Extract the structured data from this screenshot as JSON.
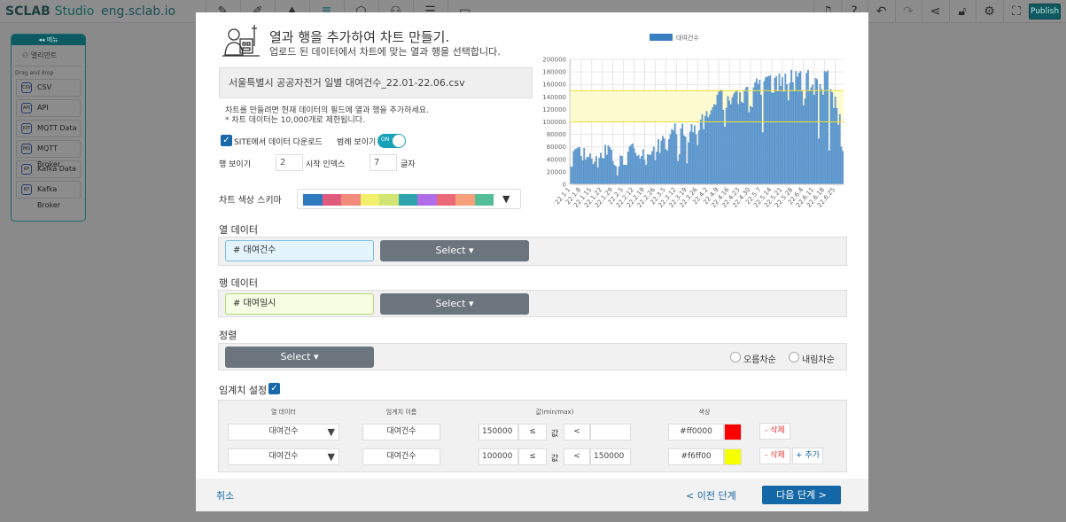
{
  "topbar": {
    "logo": "SCLAB",
    "logo_suffix": "Studio",
    "domain": "eng.sclab.io",
    "tools": [
      "edit-icon",
      "edit-alt-icon",
      "map-icon",
      "database-icon",
      "code-icon",
      "users-icon",
      "list-icon",
      "window-icon"
    ],
    "right_tools": [
      "bell-icon",
      "help-icon",
      "undo-icon",
      "redo-icon",
      "share-icon",
      "unlock-icon",
      "gear-icon",
      "fullscreen-icon"
    ],
    "publish": "Publish"
  },
  "panel": {
    "header": "메뉴",
    "client": "엘리먼트",
    "drag_label": "Drag and drop",
    "items": [
      {
        "label": "CSV",
        "icon": "CSV"
      },
      {
        "label": "API",
        "icon": "API"
      },
      {
        "label": "MQTT Data",
        "icon": "IOT"
      },
      {
        "label": "MQTT Broker",
        "icon": "MQ"
      },
      {
        "label": "Kafka Data",
        "icon": "KF"
      },
      {
        "label": "Kafka Broker",
        "icon": "KF"
      }
    ]
  },
  "modal": {
    "title": "열과 행을 추가하여 차트 만들기.",
    "subtitle": "업로드 된 데이터에서 차트에 맞는 열과 행을 선택합니다.",
    "file_name": "서울특별시 공공자전거 일별 대여건수_22.01-22.06.csv",
    "note1": "차트를 만들려면 현재 데이터의 필드에 열과 행을 추가하세요.",
    "note2": "* 차트 데이터는 10,000개로 제한됩니다.",
    "download_label": "SITE에서 데이터 다운로드",
    "download_checked": true,
    "legend_label": "범례 보이기",
    "legend_toggle": "ON",
    "rows_label": "행 보이기",
    "rows_value": "2",
    "start_index_label": "시작 인덱스",
    "start_index_value": "7",
    "chars_label": "글자",
    "color_scheme_label": "차트 색상 스키마",
    "color_scheme": [
      "#2e7bbf",
      "#e05a7e",
      "#f28b7a",
      "#f2ef6b",
      "#d2e574",
      "#2fa3ae",
      "#b06de8",
      "#ea6a7a",
      "#f5a07a",
      "#52bd96"
    ],
    "column_label": "열 데이터",
    "column_field": "# 대여건수",
    "column_select": "Select ▾",
    "row_label": "행 데이터",
    "row_field": "# 대여일시",
    "row_select": "Select ▾",
    "sort_label": "정렬",
    "sort_select": "Select ▾",
    "asc": "오름차순",
    "desc": "내림차순",
    "threshold_label": "임계치 설정",
    "threshold_checked": true,
    "threshold_headers": [
      "열 데이터",
      "임계치 이름",
      "값(min/max)",
      "색상"
    ],
    "thresholds": [
      {
        "column": "대여건수",
        "name": "대여건수",
        "min": "150000",
        "op1": "≤",
        "val": "값",
        "op2": "<",
        "max": "",
        "color": "#ff0000",
        "delete": "- 삭제"
      },
      {
        "column": "대여건수",
        "name": "대여건수",
        "min": "100000",
        "op1": "≤",
        "val": "값",
        "op2": "<",
        "max": "150000",
        "color": "#f6ff00",
        "delete": "- 삭제",
        "add": "+ 추가"
      }
    ],
    "cancel": "취소",
    "prev": "< 이전 단계",
    "next": "다음 단계 >"
  },
  "chart_data": {
    "type": "bar",
    "legend": [
      "대여건수"
    ],
    "legend_position": "top",
    "bar_color": "#3a80c0",
    "grid": true,
    "ylim": [
      0,
      200000
    ],
    "yticks": [
      0,
      20000,
      40000,
      60000,
      80000,
      100000,
      120000,
      140000,
      160000,
      180000,
      200000
    ],
    "x_tick_labels": [
      "22.1.1",
      "22.1.8",
      "22.1.15",
      "22.1.22",
      "22.1.29",
      "22.2.5",
      "22.2.12",
      "22.2.19",
      "22.2.26",
      "22.3.5",
      "22.3.12",
      "22.3.19",
      "22.3.26",
      "22.4.2",
      "22.4.9",
      "22.4.16",
      "22.4.23",
      "22.4.30",
      "22.5.7",
      "22.5.14",
      "22.5.21",
      "22.5.28",
      "22.6.4",
      "22.6.11",
      "22.6.18",
      "22.6.25"
    ],
    "thresholds": [
      {
        "min": 150000,
        "color": "#ff0000"
      },
      {
        "min": 100000,
        "max": 150000,
        "color": "#f6ff00"
      }
    ],
    "values": [
      28000,
      28000,
      53000,
      56000,
      57000,
      59000,
      59000,
      45000,
      38000,
      58000,
      39000,
      44000,
      43000,
      49000,
      41000,
      32000,
      36000,
      45000,
      27000,
      42000,
      50000,
      42000,
      41000,
      63000,
      47000,
      62000,
      59000,
      55000,
      37000,
      31000,
      29000,
      14000,
      28000,
      46000,
      45000,
      31000,
      31000,
      31000,
      52000,
      60000,
      63000,
      65000,
      58000,
      50000,
      45000,
      47000,
      41000,
      45000,
      56000,
      39000,
      31000,
      48000,
      47000,
      47000,
      53000,
      60000,
      38000,
      52000,
      72000,
      50000,
      70000,
      77000,
      73000,
      56000,
      54000,
      72000,
      80000,
      88000,
      86000,
      97000,
      80000,
      37000,
      48000,
      89000,
      97000,
      78000,
      76000,
      33000,
      67000,
      84000,
      96000,
      83000,
      94000,
      80000,
      62000,
      86000,
      103000,
      112000,
      88000,
      109000,
      117000,
      107000,
      111000,
      118000,
      123000,
      128000,
      127000,
      143000,
      148000,
      151000,
      151000,
      119000,
      92000,
      122000,
      141000,
      134000,
      128000,
      139000,
      145000,
      148000,
      149000,
      128000,
      147000,
      132000,
      130000,
      151000,
      155000,
      156000,
      115000,
      125000,
      123000,
      155000,
      163000,
      169000,
      160000,
      167000,
      143000,
      83000,
      165000,
      171000,
      172000,
      173000,
      174000,
      147000,
      146000,
      170000,
      173000,
      149000,
      177000,
      157000,
      171000,
      148000,
      177000,
      160000,
      134000,
      162000,
      183000,
      163000,
      149000,
      181000,
      172000,
      178000,
      181000,
      150000,
      126000,
      137000,
      178000,
      183000,
      150000,
      155000,
      159000,
      143000,
      170000,
      168000,
      73000,
      160000,
      152000,
      143000,
      181000,
      179000,
      182000,
      54000,
      152000,
      147000,
      122000,
      140000,
      122000,
      95000,
      112000,
      60000,
      53000
    ]
  }
}
